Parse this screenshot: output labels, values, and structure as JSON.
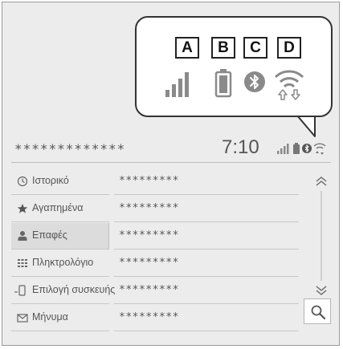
{
  "callout": {
    "labels": [
      "A",
      "B",
      "C",
      "D"
    ],
    "icons": [
      "signal-strength-icon",
      "battery-icon",
      "bluetooth-icon",
      "wifi-data-icon"
    ]
  },
  "status_bar": {
    "title": "*************",
    "time": "7:10",
    "icons": [
      "signal-strength-icon",
      "battery-icon",
      "bluetooth-icon",
      "wifi-data-icon"
    ]
  },
  "menu": {
    "items": [
      {
        "label": "Ιστορικό",
        "icon": "clock-icon",
        "value": "*********",
        "selected": false
      },
      {
        "label": "Αγαπημένα",
        "icon": "star-icon",
        "value": "*********",
        "selected": false
      },
      {
        "label": "Επαφές",
        "icon": "person-icon",
        "value": "*********",
        "selected": true
      },
      {
        "label": "Πληκτρολόγιο",
        "icon": "keypad-icon",
        "value": "*********",
        "selected": false
      },
      {
        "label": "Επιλογή συσκευής",
        "icon": "phone-device-icon",
        "value": "*********",
        "selected": false
      },
      {
        "label": "Μήνυμα",
        "icon": "envelope-icon",
        "value": "*********",
        "selected": false
      }
    ]
  },
  "scroll": {
    "up_icon": "double-chevron-up-icon",
    "down_icon": "double-chevron-down-icon",
    "search_icon": "search-icon"
  }
}
